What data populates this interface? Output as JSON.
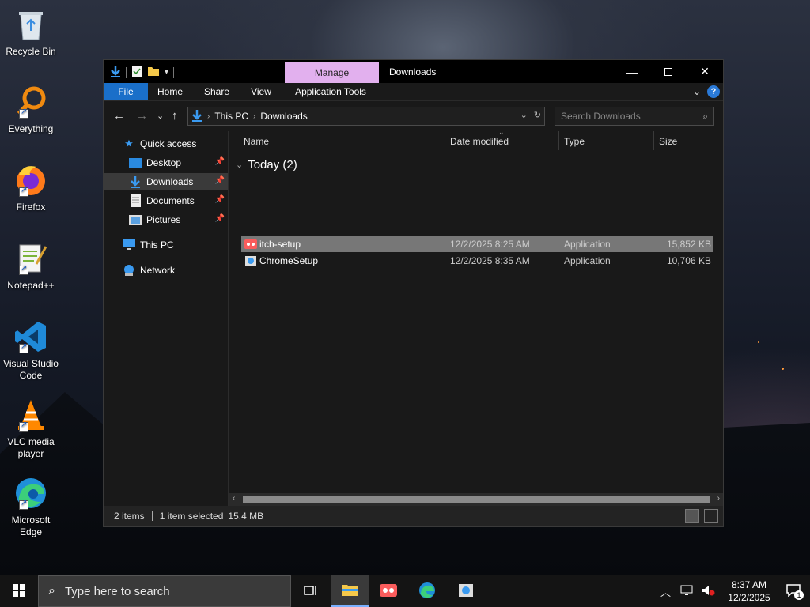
{
  "desktop": {
    "icons": [
      {
        "label": "Recycle Bin",
        "icon": "recycle-bin-icon"
      },
      {
        "label": "Everything",
        "icon": "everything-icon"
      },
      {
        "label": "Firefox",
        "icon": "firefox-icon"
      },
      {
        "label": "Notepad++",
        "icon": "notepad-plus-plus-icon"
      },
      {
        "label": "Visual Studio Code",
        "icon": "vscode-icon"
      },
      {
        "label": "VLC media player",
        "icon": "vlc-icon"
      },
      {
        "label": "Microsoft Edge",
        "icon": "edge-icon"
      }
    ]
  },
  "window": {
    "title": "Downloads",
    "contextual_tab": "Manage",
    "ribbon_tabs": [
      "File",
      "Home",
      "Share",
      "View",
      "Application Tools"
    ],
    "nav": {
      "back": "←",
      "forward": "→",
      "recent": "⌄",
      "up": "↑"
    },
    "address": {
      "crumbs": [
        "This PC",
        "Downloads"
      ]
    },
    "search": {
      "placeholder": "Search Downloads"
    },
    "navpane": [
      {
        "label": "Quick access",
        "icon": "star-icon",
        "pinned": false
      },
      {
        "label": "Desktop",
        "icon": "desktop-folder-icon",
        "pinned": true
      },
      {
        "label": "Downloads",
        "icon": "downloads-folder-icon",
        "pinned": true,
        "selected": true
      },
      {
        "label": "Documents",
        "icon": "documents-folder-icon",
        "pinned": true
      },
      {
        "label": "Pictures",
        "icon": "pictures-folder-icon",
        "pinned": true
      },
      {
        "label": "This PC",
        "icon": "computer-icon",
        "pinned": false
      },
      {
        "label": "Network",
        "icon": "network-icon",
        "pinned": false
      }
    ],
    "columns": [
      "Name",
      "Date modified",
      "Type",
      "Size"
    ],
    "group_label": "Today (2)",
    "files": [
      {
        "name": "itch-setup",
        "date": "12/2/2025 8:25 AM",
        "type": "Application",
        "size": "15,852 KB",
        "selected": true,
        "icon": "itch-icon"
      },
      {
        "name": "ChromeSetup",
        "date": "12/2/2025 8:35 AM",
        "type": "Application",
        "size": "10,706 KB",
        "selected": false,
        "icon": "installer-icon"
      }
    ],
    "status": {
      "items": "2 items",
      "selected": "1 item selected",
      "size": "15.4 MB"
    }
  },
  "taskbar": {
    "search_placeholder": "Type here to search",
    "time": "8:37 AM",
    "date": "12/2/2025",
    "notification_count": "1"
  },
  "colors": {
    "manage_tab": "#e2b0ee",
    "file_tab": "#1a6fc9",
    "selection": "#777777",
    "window_bg": "#191919"
  }
}
